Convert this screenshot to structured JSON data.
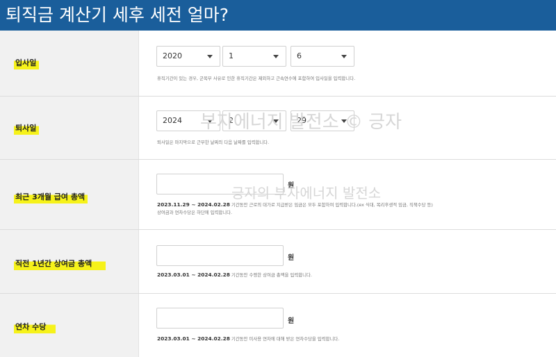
{
  "banner": {
    "title": "퇴직금 계산기 세후 세전 얼마?"
  },
  "watermarks": [
    "부자에너지 발전소 © 긍자",
    "긍자의 부자에너지 발전소"
  ],
  "hire_date": {
    "label": "입사일",
    "year": "2020",
    "month": "1",
    "day": "6",
    "hint": "휴직기간이 있는 경우, 군복무 사유로 인한 휴직기간은 제외하고 근속연수에 포함하여 입사일을 입력합니다."
  },
  "leave_date": {
    "label": "퇴사일",
    "year": "2024",
    "month": "2",
    "day": "29",
    "hint": "퇴사일은 마지막으로 근무한 날짜의 다음 날짜를 입력합니다."
  },
  "salary_3m": {
    "label": "최근 3개월 급여 총액",
    "value": "",
    "unit": "원",
    "period": "2023.11.29 ~ 2024.02.28",
    "hint": "기간동안 근로의 대가로 지급받은 임금은 모두 포함하여 입력합니다.(ex 식대, 복리후생적 임금, 직책수당 등)",
    "hint2": "상여금과 연차수당은 하단에 입력합니다."
  },
  "bonus_1y": {
    "label": "직전 1년간 상여금 총액",
    "value": "",
    "unit": "원",
    "period": "2023.03.01 ~ 2024.02.28",
    "hint": "기간동안 수령한 상여금 총액을 입력합니다."
  },
  "annual_leave": {
    "label": "연차 수당",
    "value": "",
    "unit": "원",
    "period": "2023.03.01 ~ 2024.02.28",
    "hint": "기간동안 미사용 연차에 대해 받은 연차수당을 입력합니다."
  },
  "colors": {
    "banner": "#1a5e9b",
    "highlight": "#f6f21a",
    "label_bg": "#f1f1f1"
  },
  "icons": {
    "select_arrow": "caret-down-icon"
  }
}
